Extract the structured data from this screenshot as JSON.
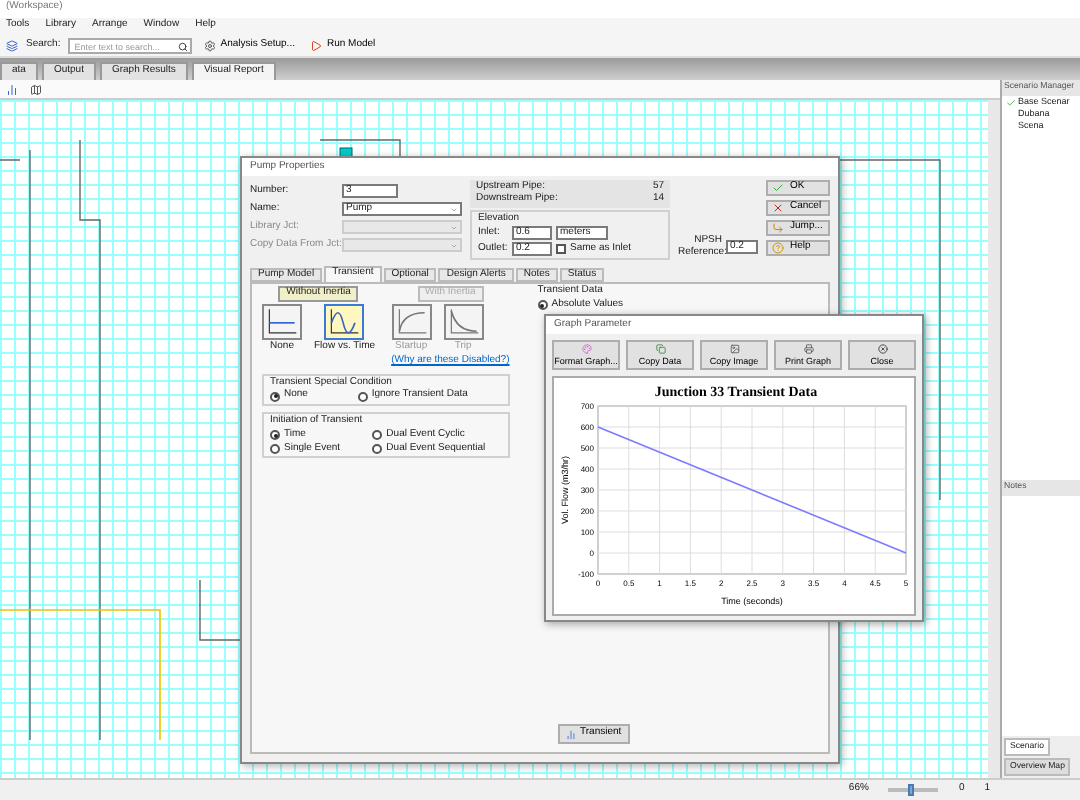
{
  "window": {
    "title": "(Workspace)"
  },
  "menu": [
    "Tools",
    "Library",
    "Arrange",
    "Window",
    "Help"
  ],
  "toolbar": {
    "search_label": "Search:",
    "search": {
      "placeholder": "Enter text to search..."
    },
    "buttons": [
      {
        "label": "Analysis Setup...",
        "kind": "setup"
      },
      {
        "label": "Run Model",
        "kind": "run"
      }
    ]
  },
  "tabs": [
    {
      "label": "ata",
      "selected": false
    },
    {
      "label": "Output",
      "selected": false
    },
    {
      "label": "Graph Results",
      "selected": false
    },
    {
      "label": "Visual Report",
      "selected": true
    }
  ],
  "scenario_manager": {
    "title": "Scenario Manager",
    "tree": [
      {
        "label": "Base Scenar",
        "children": [
          {
            "label": "Dubana"
          },
          {
            "label": "Scena"
          }
        ]
      }
    ]
  },
  "notes": {
    "title": "Notes"
  },
  "side_tabs": [
    {
      "label": "Scenario",
      "selected": true
    },
    {
      "label": "Overview Map",
      "selected": false
    }
  ],
  "status_bar": {
    "zoom": "66%",
    "zoom_slider": {
      "level": 0.45
    },
    "warnings": "0",
    "count": "1"
  },
  "pump_dialog": {
    "title": "Pump Properties",
    "fields": [
      {
        "label": "Number:",
        "value": "3",
        "kind": "text",
        "disabled": false
      },
      {
        "label": "Name:",
        "value": "Pump",
        "kind": "dropdown",
        "disabled": false
      },
      {
        "label": "Library Jct:",
        "kind": "dropdown",
        "disabled": true
      },
      {
        "label": "Copy Data From Jct:",
        "kind": "dropdown",
        "disabled": true
      }
    ],
    "pipes": [
      {
        "label": "Upstream Pipe:",
        "value": "57"
      },
      {
        "label": "Downstream Pipe:",
        "value": "14"
      }
    ],
    "elevation": {
      "title": "Elevation",
      "inlet": {
        "label": "Inlet:",
        "value": "0.6",
        "unit": "meters"
      },
      "outlet": {
        "label": "Outlet:",
        "value": "0.2"
      },
      "same_as_inlet": {
        "label": "Same as Inlet",
        "checked": false
      },
      "npsh": {
        "label": "NPSH Reference:",
        "value": "0.2"
      }
    },
    "buttons": [
      {
        "label": "OK",
        "kind": "ok"
      },
      {
        "label": "Cancel",
        "kind": "cancel"
      },
      {
        "label": "Jump...",
        "kind": "jump"
      },
      {
        "label": "Help",
        "kind": "help"
      }
    ],
    "tabs": [
      {
        "label": "Pump Model",
        "selected": false
      },
      {
        "label": "Transient",
        "selected": true
      },
      {
        "label": "Optional",
        "selected": false
      },
      {
        "label": "Design Alerts",
        "selected": false
      },
      {
        "label": "Notes",
        "selected": false
      },
      {
        "label": "Status",
        "selected": false
      }
    ],
    "without_inertia": {
      "title": "Without Inertia",
      "options": [
        {
          "label": "None",
          "kind": "flat",
          "selected": false
        },
        {
          "label": "Flow vs. Time",
          "kind": "wave",
          "selected": true
        }
      ]
    },
    "with_inertia": {
      "title": "With Inertia",
      "disabled": true,
      "options": [
        {
          "label": "Startup",
          "kind": "rise"
        },
        {
          "label": "Trip",
          "kind": "fall"
        }
      ],
      "link": "(Why are these Disabled?)"
    },
    "special_condition": {
      "title": "Transient Special Condition",
      "options": [
        {
          "label": "None",
          "selected": true
        },
        {
          "label": "Ignore Transient Data",
          "selected": false
        }
      ]
    },
    "initiation": {
      "title": "Initiation of Transient",
      "options": [
        {
          "label": "Time",
          "selected": true
        },
        {
          "label": "Dual Event Cyclic",
          "selected": false
        },
        {
          "label": "Single Event",
          "selected": false
        },
        {
          "label": "Dual Event Sequential",
          "selected": false
        }
      ]
    },
    "transient_data": {
      "title": "Transient Data",
      "options": [
        {
          "label": "Absolute Values",
          "selected": true
        }
      ]
    },
    "transient_button": "Transient"
  },
  "graph_window": {
    "title": "Graph Parameter",
    "buttons": [
      {
        "label": "Format Graph...",
        "kind": "format"
      },
      {
        "label": "Copy Data",
        "kind": "copy"
      },
      {
        "label": "Copy Image",
        "kind": "image"
      },
      {
        "label": "Print Graph",
        "kind": "print"
      },
      {
        "label": "Close",
        "kind": "close"
      }
    ],
    "chart_data": {
      "type": "line",
      "title": "Junction 33 Transient Data",
      "xlabel": "Time (seconds)",
      "ylabel": "Vol. Flow (m3/hr)",
      "x": [
        0,
        5
      ],
      "grid": true,
      "series": [
        {
          "color": "#7b7bff",
          "values": [
            600,
            0
          ]
        }
      ],
      "xlim": [
        0,
        5
      ],
      "ylim": [
        -100,
        700
      ],
      "xticks": [
        0,
        0.5,
        1,
        1.5,
        2,
        2.5,
        3,
        3.5,
        4,
        4.5,
        5
      ],
      "yticks": [
        -100,
        0,
        100,
        200,
        300,
        400,
        500,
        600,
        700
      ]
    }
  }
}
